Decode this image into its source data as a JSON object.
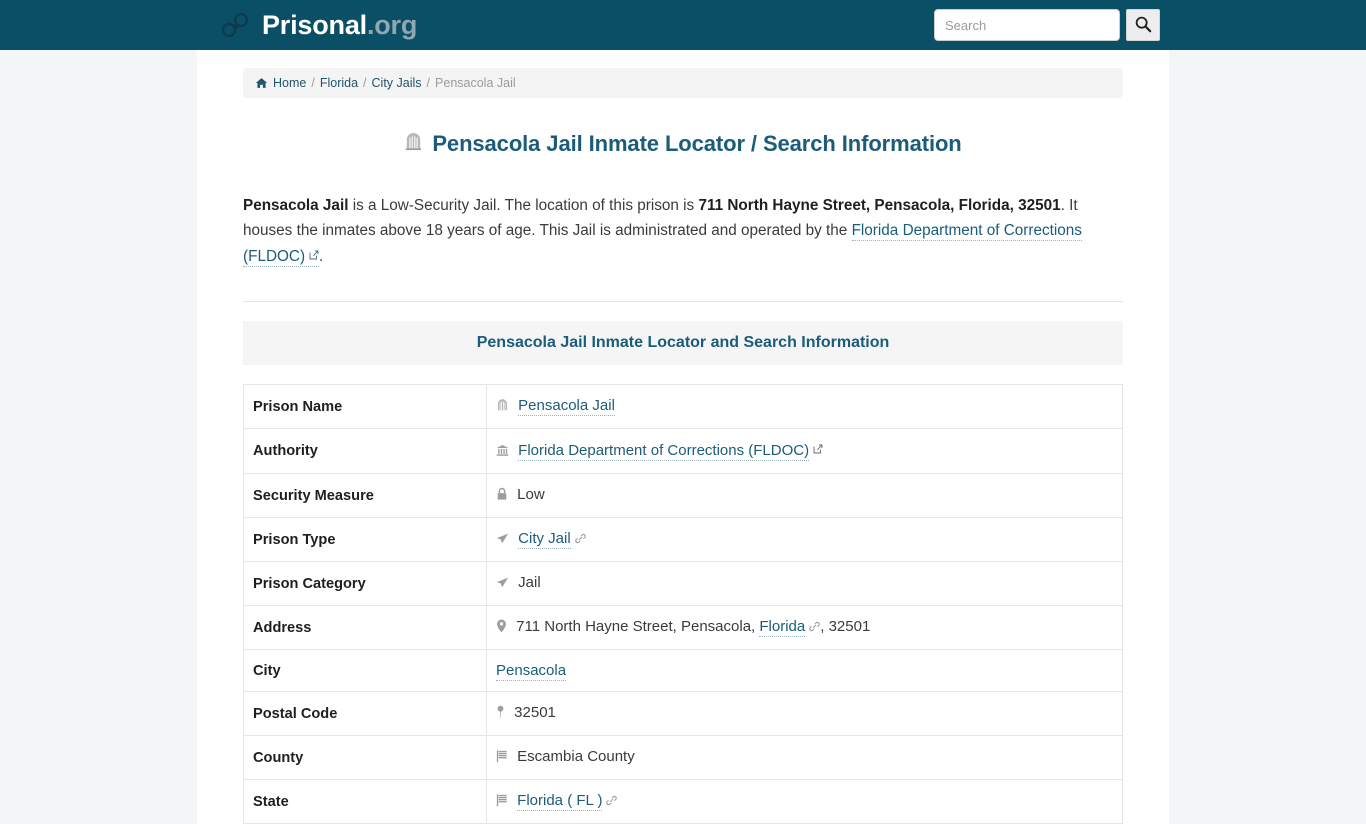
{
  "header": {
    "brand_name": "Prisonal",
    "brand_tld": ".org",
    "logo_icon": "handcuffs-icon",
    "search": {
      "placeholder": "Search",
      "value": "",
      "button_icon": "search-icon"
    }
  },
  "breadcrumb": {
    "home_icon": "home-icon",
    "items": [
      {
        "label": "Home",
        "current": false
      },
      {
        "label": "Florida",
        "current": false
      },
      {
        "label": "City Jails",
        "current": false
      },
      {
        "label": "Pensacola Jail",
        "current": true
      }
    ],
    "separator": "/"
  },
  "page": {
    "title": "Pensacola Jail Inmate Locator / Search Information",
    "title_icon": "jail-building-icon"
  },
  "intro": {
    "prison_name": "Pensacola Jail",
    "part1": " is a Low-Security Jail. The location of this prison is ",
    "address_bold": "711 North Hayne Street, Pensacola, Florida, 32501",
    "part2": ". It houses the inmates above 18 years of age. This Jail is administrated and operated by the ",
    "authority_link": "Florida Department of Corrections (FLDOC)",
    "authority_link_icon": "external-link-icon",
    "part3": "."
  },
  "table": {
    "caption": "Pensacola Jail Inmate Locator and Search Information",
    "rows": [
      {
        "label": "Prison Name",
        "icon": "jail-building-icon",
        "value": "Pensacola Jail",
        "is_link": true,
        "suffix_icon": null,
        "extra": ""
      },
      {
        "label": "Authority",
        "icon": "landmark-icon",
        "value": "Florida Department of Corrections (FLDOC)",
        "is_link": true,
        "suffix_icon": "external-link-icon",
        "extra": ""
      },
      {
        "label": "Security Measure",
        "icon": "lock-icon",
        "value": "Low",
        "is_link": false,
        "suffix_icon": null,
        "extra": ""
      },
      {
        "label": "Prison Type",
        "icon": "paper-plane-icon",
        "value": "City Jail",
        "is_link": true,
        "suffix_icon": "chain-link-icon",
        "extra": ""
      },
      {
        "label": "Prison Category",
        "icon": "paper-plane-icon",
        "value": "Jail",
        "is_link": false,
        "suffix_icon": null,
        "extra": ""
      },
      {
        "label": "Address",
        "icon": "map-marker-icon",
        "prefix": "711 North Hayne Street, Pensacola, ",
        "value": "Florida",
        "is_link": true,
        "suffix_icon": "chain-link-icon",
        "extra": ", 32501"
      },
      {
        "label": "City",
        "icon": null,
        "value": "Pensacola",
        "is_link": true,
        "suffix_icon": null,
        "extra": ""
      },
      {
        "label": "Postal Code",
        "icon": "map-pin-icon",
        "value": "32501",
        "is_link": false,
        "suffix_icon": null,
        "extra": ""
      },
      {
        "label": "County",
        "icon": "flag-icon",
        "value": "Escambia County",
        "is_link": false,
        "suffix_icon": null,
        "extra": ""
      },
      {
        "label": "State",
        "icon": "flag-icon",
        "value": "Florida ( FL )",
        "is_link": true,
        "suffix_icon": "chain-link-icon",
        "extra": ""
      }
    ]
  },
  "colors": {
    "header_bg": "#0b4f66",
    "link": "#1b5c7a",
    "title": "#1b5c7a",
    "page_bg": "#f4f5f7",
    "caption_bg": "#f5f5f6"
  }
}
